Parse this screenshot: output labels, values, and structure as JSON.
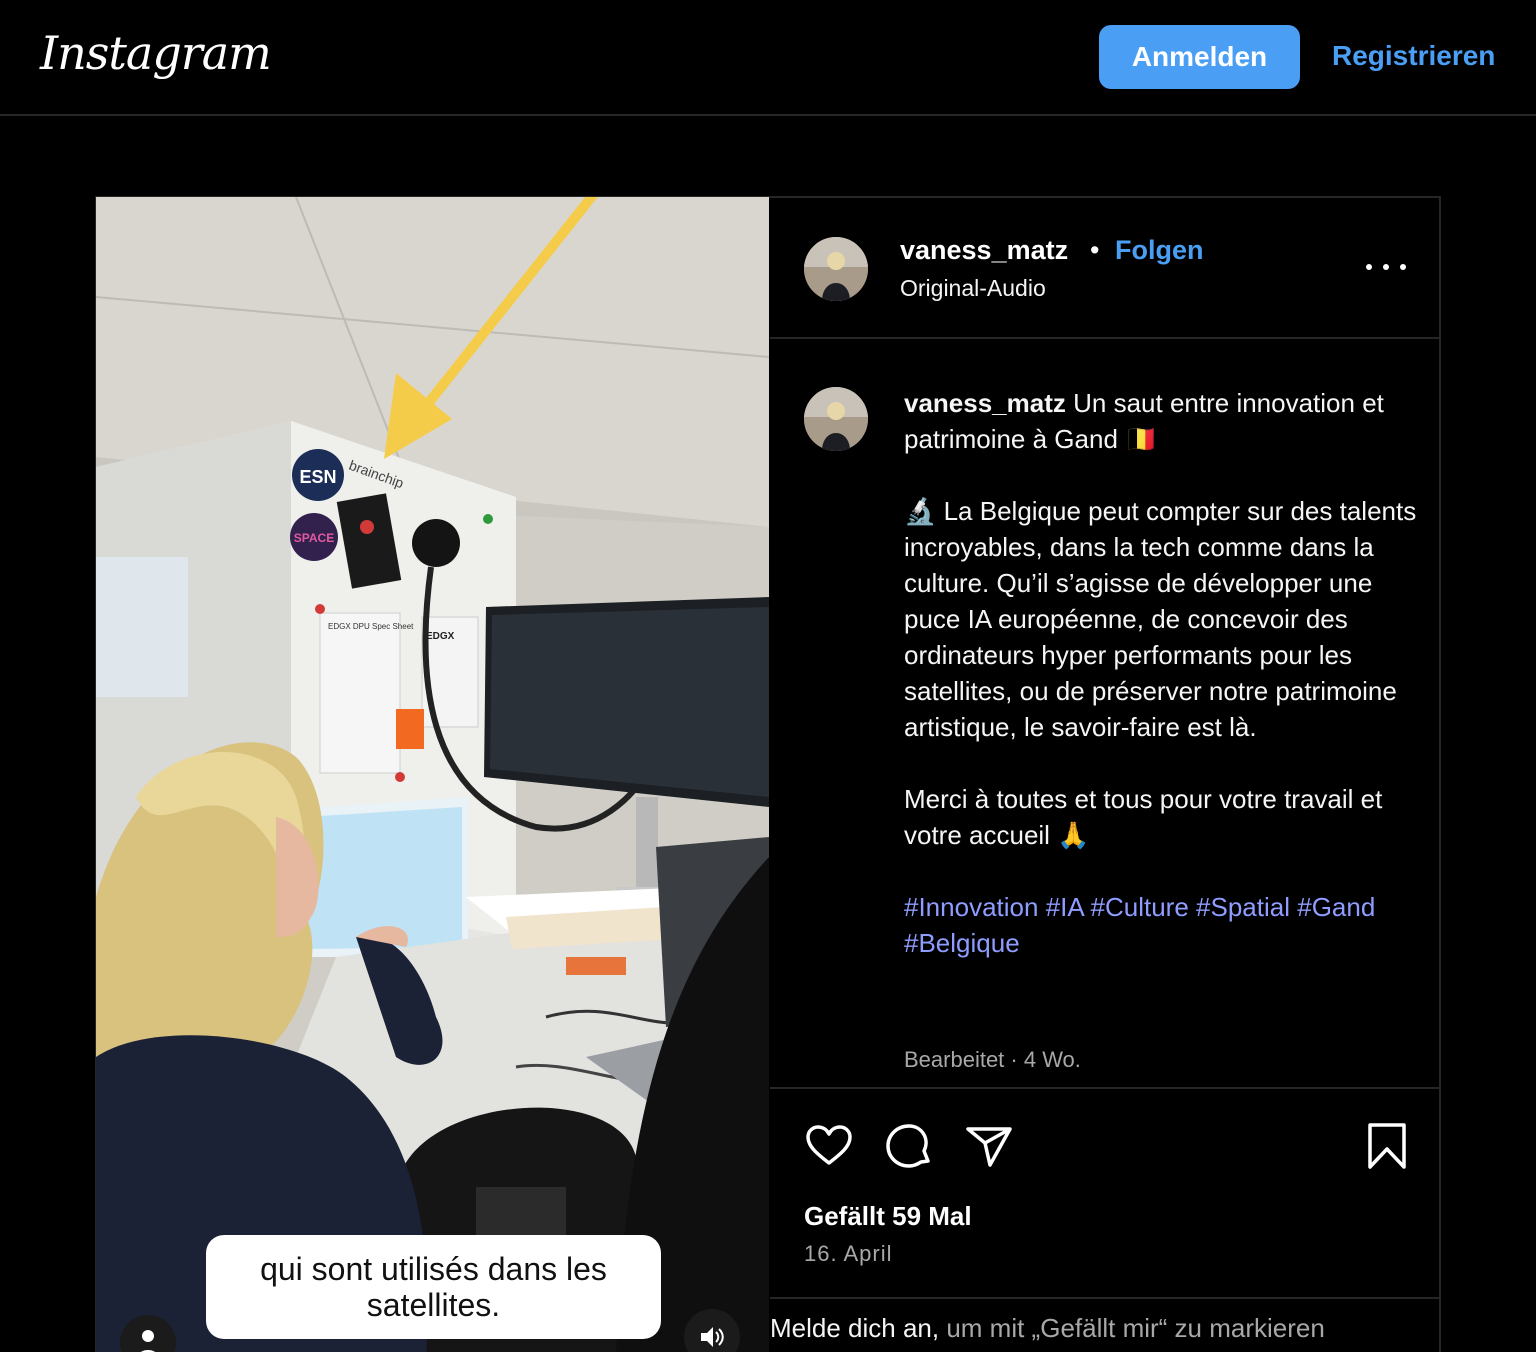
{
  "header": {
    "logo": "Instagram",
    "login_label": "Anmelden",
    "register_label": "Registrieren"
  },
  "post": {
    "username": "vaness_matz",
    "follow_label": "Folgen",
    "separator": "•",
    "audio_label": "Original-Audio",
    "more_icon": "more-horizontal-icon",
    "video_caption_line1": "qui sont utilisés dans les",
    "video_caption_line2": "satellites.",
    "caption": {
      "line1": "Un saut entre innovation et patrimoine à Gand 🇧🇪",
      "paragraph2": "🔬 La Belgique peut compter sur des talents incroyables, dans la tech comme dans la culture. Qu’il s’agisse de développer une puce IA européenne, de concevoir des ordinateurs hyper performants pour les satellites, ou de préserver notre patrimoine artistique, le savoir-faire est là.",
      "paragraph3": "Merci à toutes et tous pour votre travail et votre accueil 🙏",
      "hashtags": [
        "#Innovation",
        "#IA",
        "#Culture",
        "#Spatial",
        "#Gand",
        "#Belgique"
      ]
    },
    "meta": "Bearbeitet · 4 Wo.",
    "likes": "Gefällt 59 Mal",
    "date": "16. April",
    "login_prompt_link": "Melde dich an,",
    "login_prompt_text": " um mit „Gefällt mir“ zu markieren"
  },
  "sticker_labels": {
    "esn": "ESN",
    "brainchip": "brainchip",
    "space": "SPACE",
    "edgx": "EDGX",
    "spec_sheet": "EDGX DPU Spec Sheet"
  },
  "colors": {
    "accent_blue": "#4a9ff5",
    "hashtag": "#8e9dff",
    "annotation_arrow": "#f5cc4a",
    "border": "#262626"
  }
}
